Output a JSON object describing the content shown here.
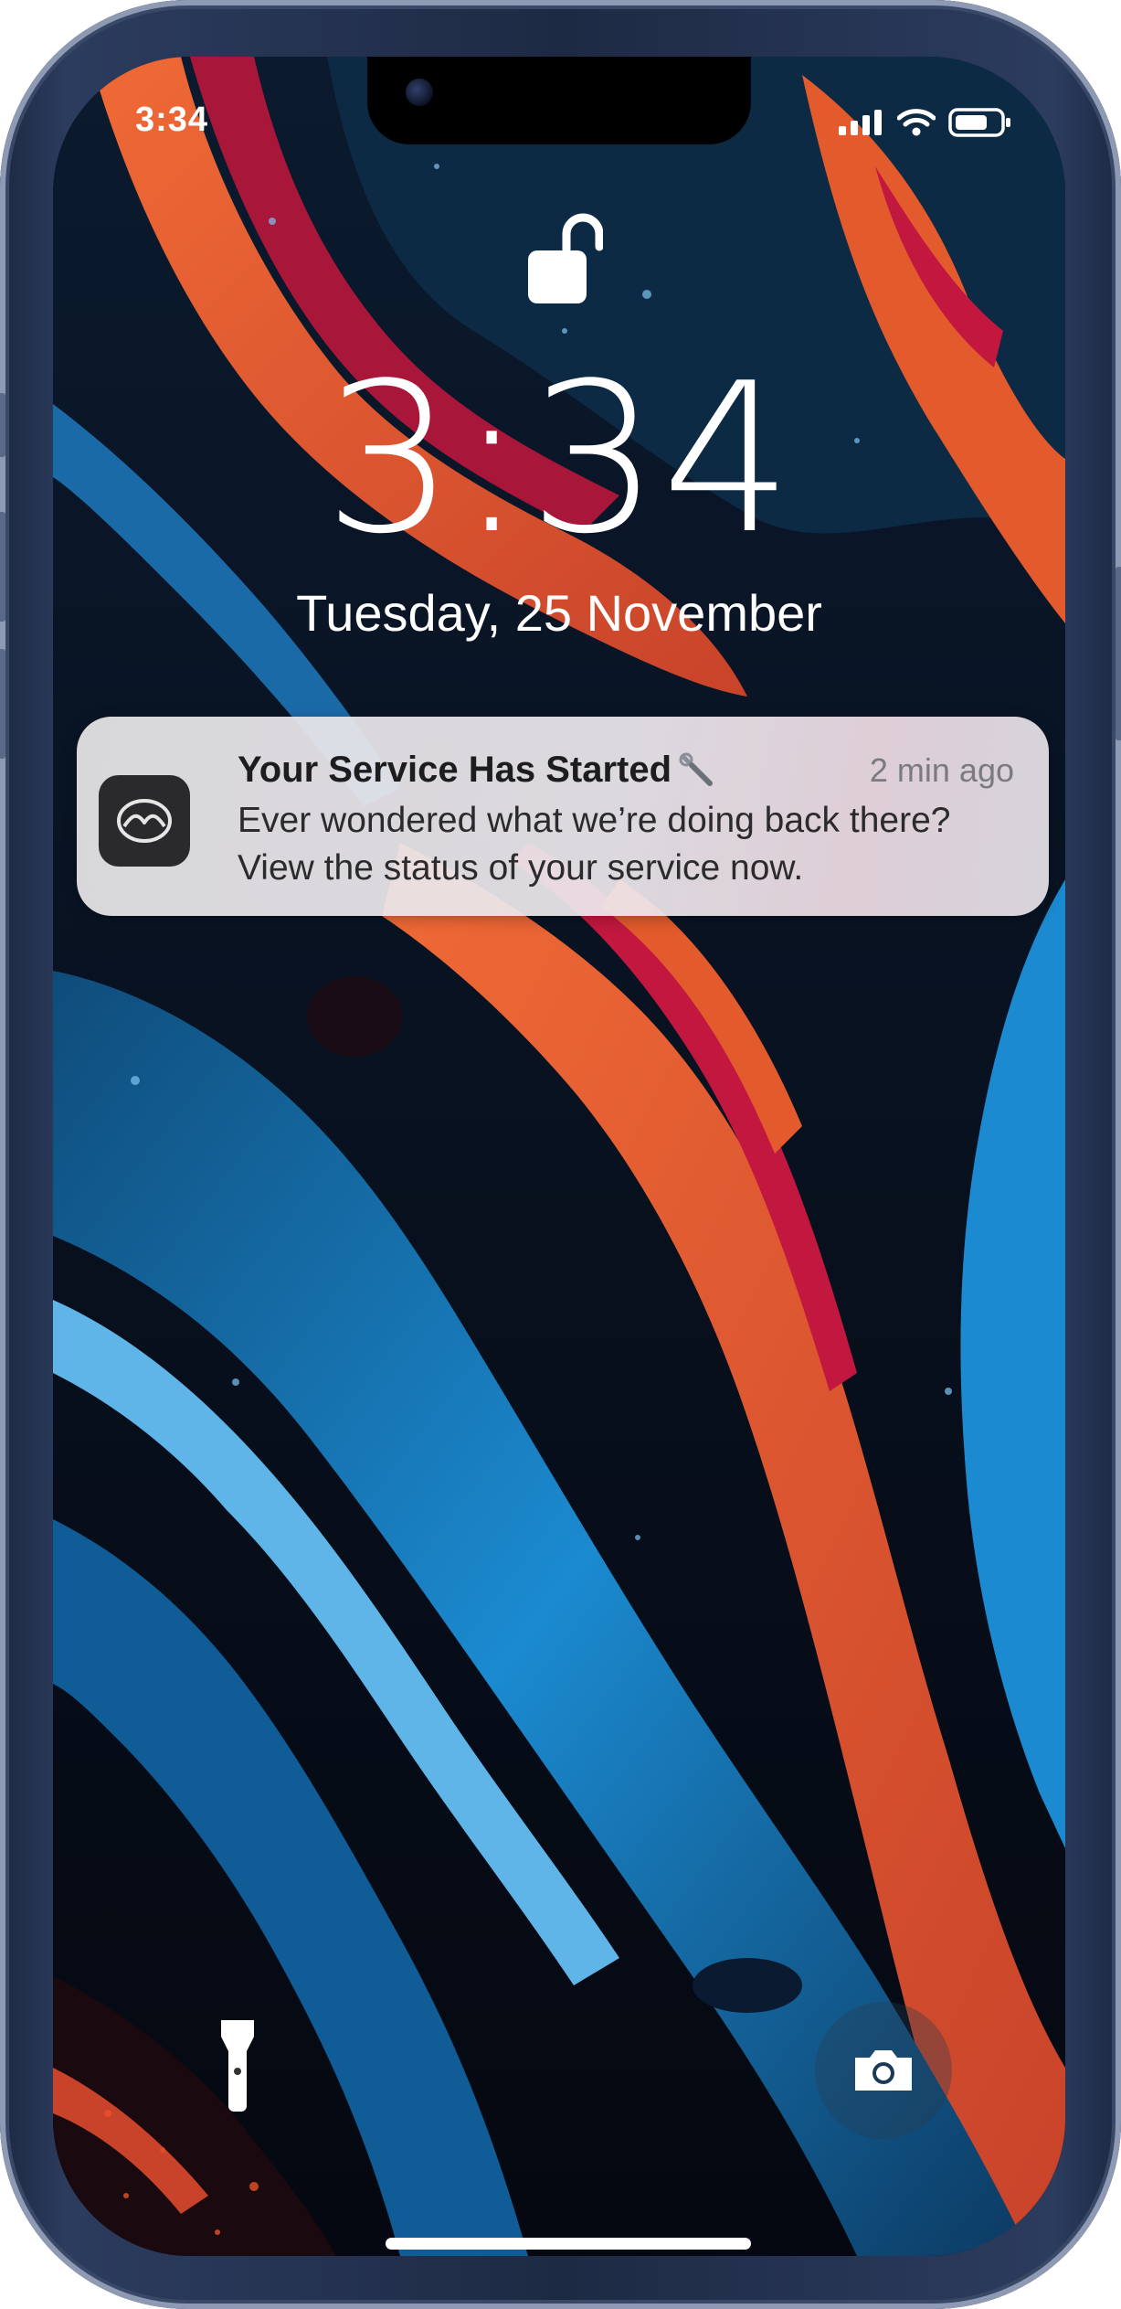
{
  "status_bar": {
    "time": "3:34",
    "icons": [
      "cellular-signal-icon",
      "wifi-icon",
      "battery-icon"
    ]
  },
  "lock_screen": {
    "lock_icon": "unlocked-padlock-icon",
    "clock": "3:34",
    "date": "Tuesday,  25 November"
  },
  "notification": {
    "app_icon": "mazda-logo-icon",
    "title": "Your Service Has Started",
    "title_emoji": "wrench-icon",
    "time_ago": "2 min ago",
    "body_line_1": "Ever wondered what we’re doing back there?",
    "body_line_2": "View the status of your service now."
  },
  "quick_actions": {
    "left": "flashlight-icon",
    "right": "camera-icon"
  },
  "colors": {
    "frame": "#24324f",
    "notification_bg": "#e8e6e8",
    "wallpaper_orange": "#e35a2c",
    "wallpaper_blue": "#1b8ad0",
    "wallpaper_crimson": "#c2183f"
  }
}
